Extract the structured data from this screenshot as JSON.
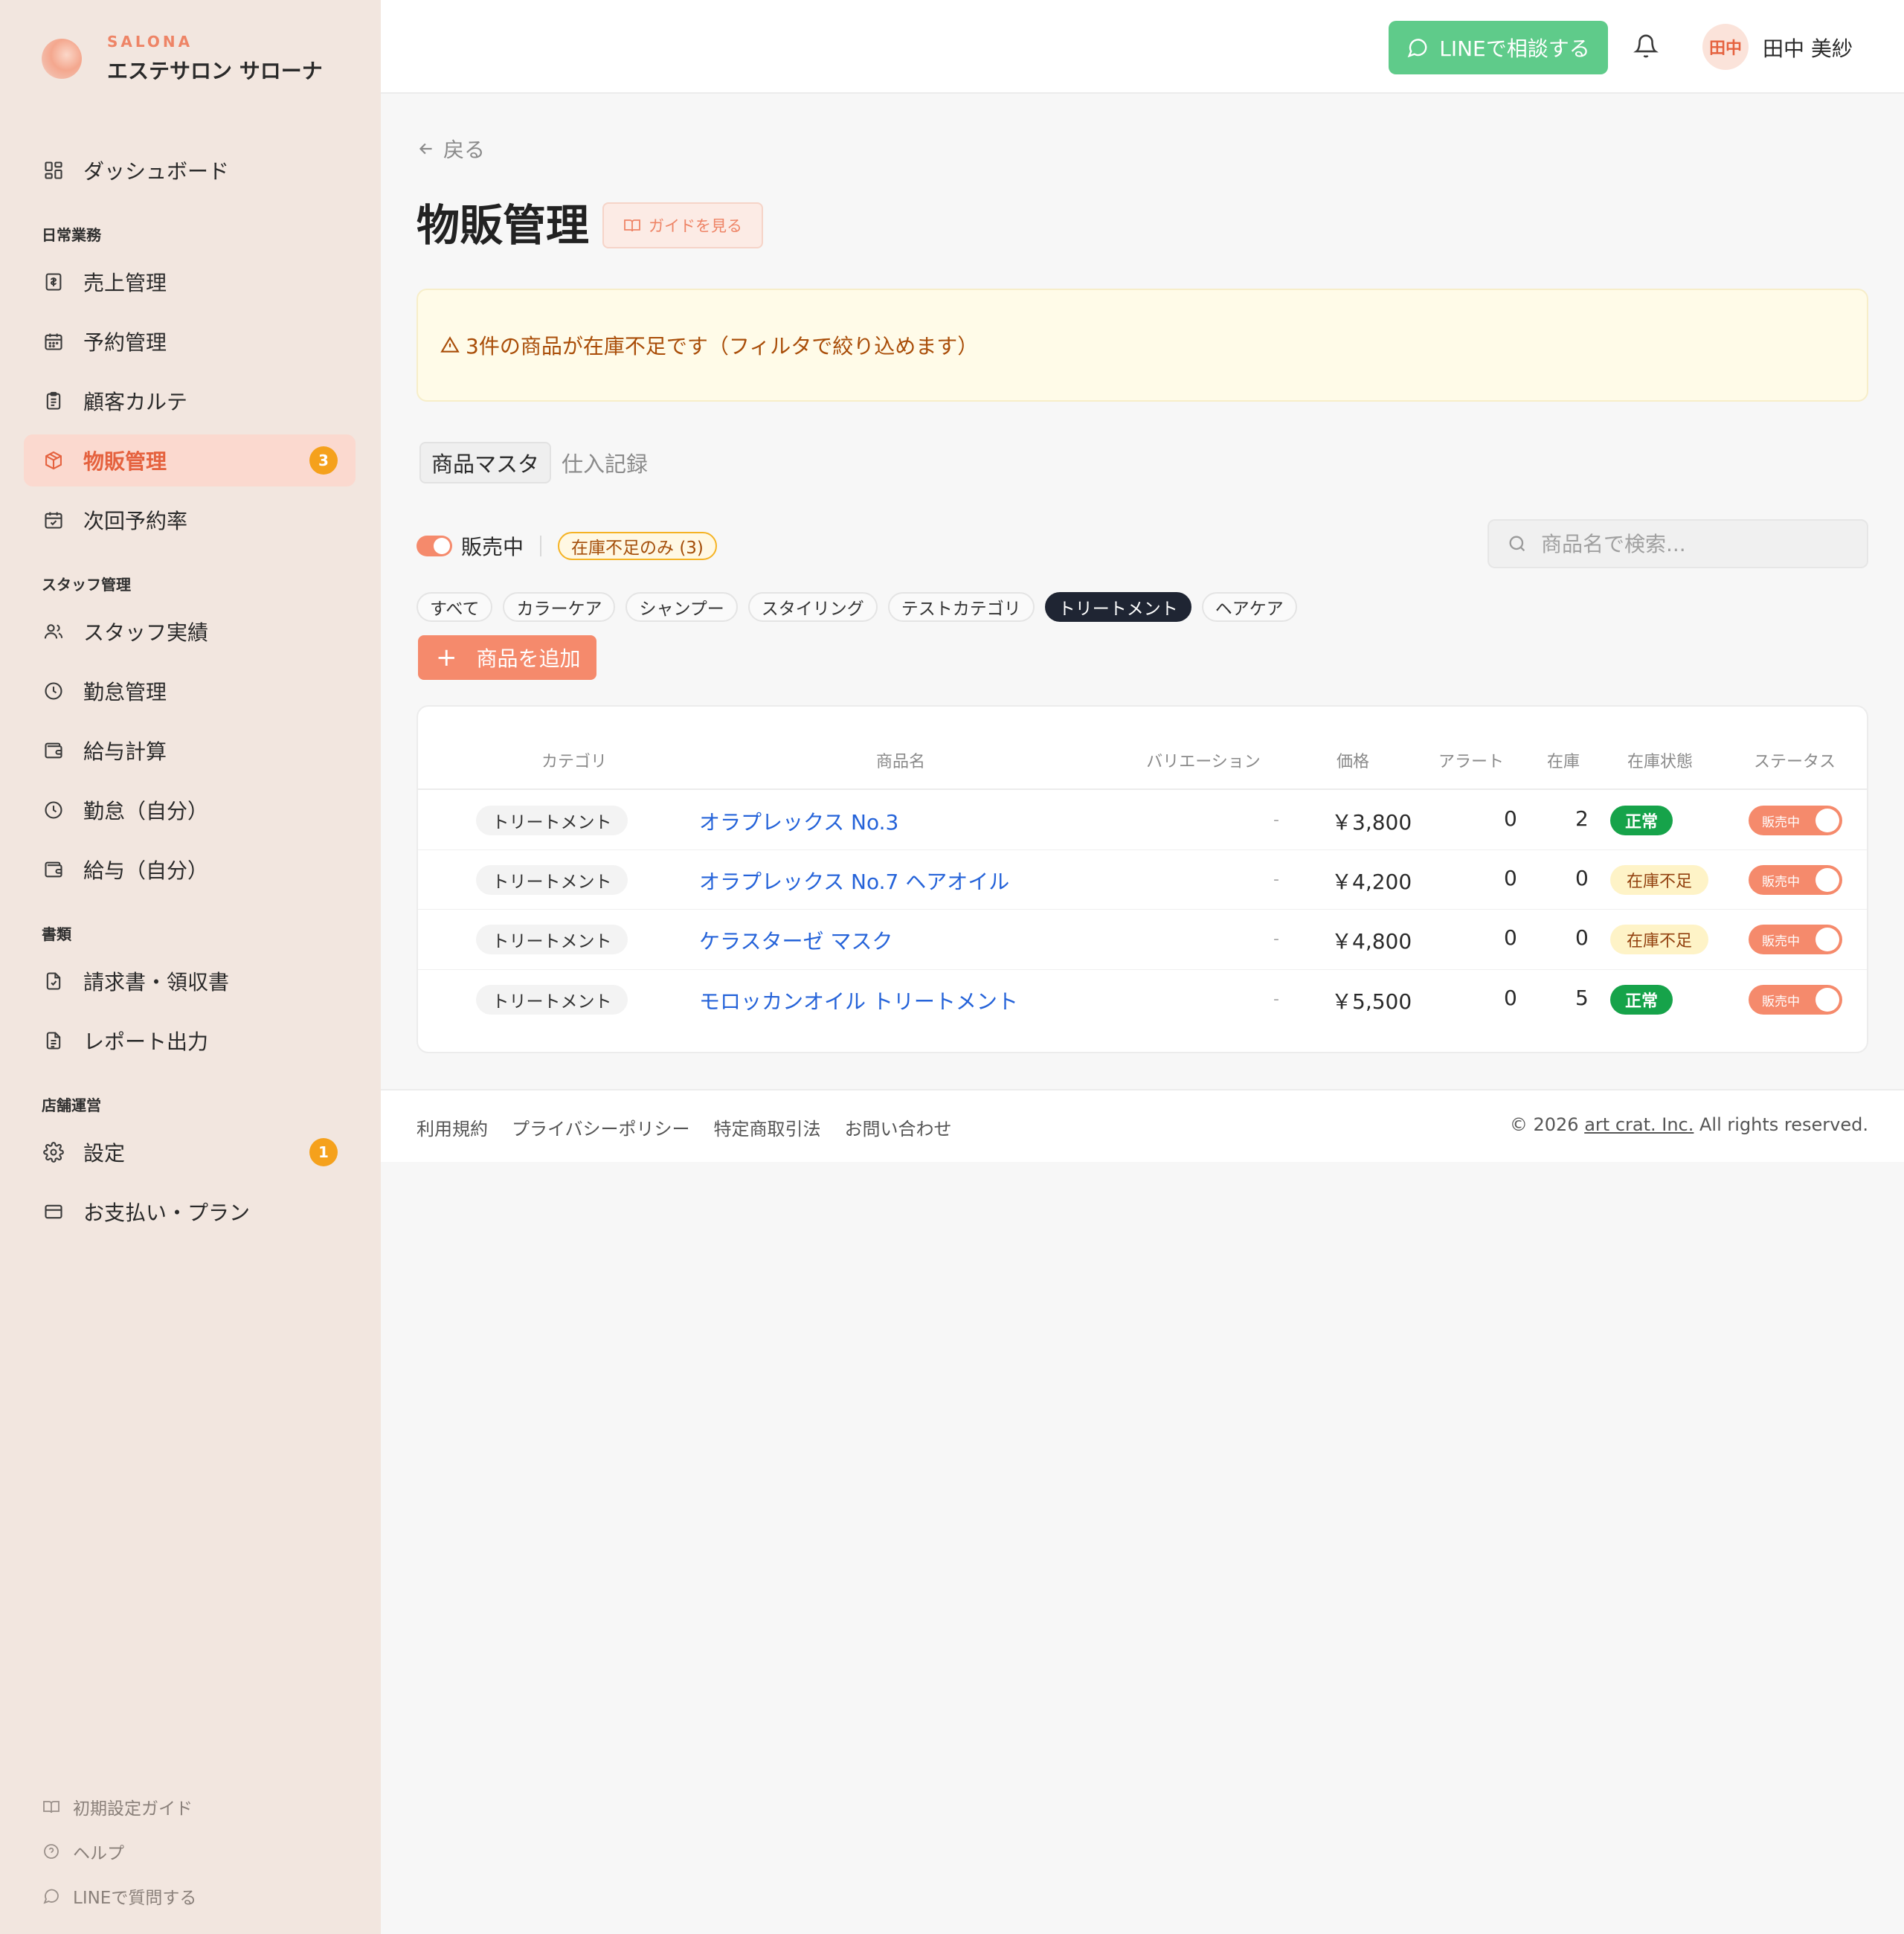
{
  "brand": {
    "en": "SALONA",
    "ja": "エステサロン サローナ"
  },
  "sidebar": {
    "top_item": {
      "label": "ダッシュボード",
      "icon": "dashboard-grid-icon"
    },
    "sections": [
      {
        "title": "日常業務",
        "items": [
          {
            "label": "売上管理",
            "icon": "receipt-icon"
          },
          {
            "label": "予約管理",
            "icon": "calendar-icon"
          },
          {
            "label": "顧客カルテ",
            "icon": "clipboard-icon"
          },
          {
            "label": "物販管理",
            "icon": "package-icon",
            "badge": "3",
            "active": true
          },
          {
            "label": "次回予約率",
            "icon": "calendar-check-icon"
          }
        ]
      },
      {
        "title": "スタッフ管理",
        "items": [
          {
            "label": "スタッフ実績",
            "icon": "users-icon"
          },
          {
            "label": "勤怠管理",
            "icon": "clock-icon"
          },
          {
            "label": "給与計算",
            "icon": "wallet-icon"
          },
          {
            "label": "勤怠（自分）",
            "icon": "clock-icon"
          },
          {
            "label": "給与（自分）",
            "icon": "wallet-icon"
          }
        ]
      },
      {
        "title": "書類",
        "items": [
          {
            "label": "請求書・領収書",
            "icon": "invoice-icon"
          },
          {
            "label": "レポート出力",
            "icon": "report-icon"
          }
        ]
      },
      {
        "title": "店舗運営",
        "items": [
          {
            "label": "設定",
            "icon": "gear-icon",
            "badge": "1"
          },
          {
            "label": "お支払い・プラン",
            "icon": "credit-card-icon"
          }
        ]
      }
    ],
    "footer_links": [
      {
        "label": "初期設定ガイド",
        "icon": "book-icon"
      },
      {
        "label": "ヘルプ",
        "icon": "help-icon"
      },
      {
        "label": "LINEで質問する",
        "icon": "chat-icon"
      }
    ]
  },
  "header": {
    "line_button": "LINEで相談する",
    "avatar_initials": "田中",
    "user_name": "田中 美紗"
  },
  "page": {
    "back": "戻る",
    "title": "物販管理",
    "guide_button": "ガイドを見る",
    "alert": "3件の商品が在庫不足です（フィルタで絞り込めます）",
    "tabs": [
      "商品マスタ",
      "仕入記録"
    ],
    "active_tab": "商品マスタ",
    "toggle_label": "販売中",
    "shortage_filter": "在庫不足のみ (3)",
    "search_placeholder": "商品名で検索...",
    "categories": [
      "すべて",
      "カラーケア",
      "シャンプー",
      "スタイリング",
      "テストカテゴリ",
      "トリートメント",
      "ヘアケア"
    ],
    "active_category": "トリートメント",
    "add_button": "商品を追加"
  },
  "table": {
    "headers": [
      "カテゴリ",
      "商品名",
      "バリエーション",
      "価格",
      "アラート",
      "在庫",
      "在庫状態",
      "ステータス"
    ],
    "rows": [
      {
        "category": "トリートメント",
        "name": "オラプレックス No.3",
        "variation": "-",
        "price": "￥3,800",
        "alert": "0",
        "stock": "2",
        "stock_status": "正常",
        "status": "販売中"
      },
      {
        "category": "トリートメント",
        "name": "オラプレックス No.7 ヘアオイル",
        "variation": "-",
        "price": "￥4,200",
        "alert": "0",
        "stock": "0",
        "stock_status": "在庫不足",
        "status": "販売中"
      },
      {
        "category": "トリートメント",
        "name": "ケラスターゼ マスク",
        "variation": "-",
        "price": "￥4,800",
        "alert": "0",
        "stock": "0",
        "stock_status": "在庫不足",
        "status": "販売中"
      },
      {
        "category": "トリートメント",
        "name": "モロッカンオイル トリートメント",
        "variation": "-",
        "price": "￥5,500",
        "alert": "0",
        "stock": "5",
        "stock_status": "正常",
        "status": "販売中"
      }
    ]
  },
  "footer": {
    "links": [
      "利用規約",
      "プライバシーポリシー",
      "特定商取引法",
      "お問い合わせ"
    ],
    "copyright_prefix": "© 2026",
    "company": "art crat. Inc.",
    "copyright_suffix": "All rights reserved."
  },
  "colors": {
    "accent": "#f58a6c",
    "accent_text": "#e5623f",
    "line_green": "#5fcb8a",
    "badge_orange": "#f5a11c",
    "link_blue": "#2563d9",
    "ok_green": "#16a34a",
    "warn_bg": "#fef3c7"
  }
}
